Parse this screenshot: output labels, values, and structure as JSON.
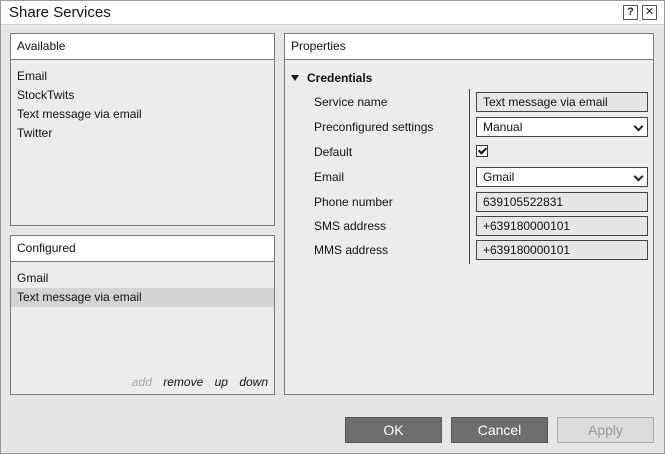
{
  "window": {
    "title": "Share Services",
    "help_label": "?",
    "close_label": "✕"
  },
  "available": {
    "header": "Available",
    "items": [
      "Email",
      "StockTwits",
      "Text message via email",
      "Twitter"
    ]
  },
  "configured": {
    "header": "Configured",
    "items": [
      "Gmail",
      "Text message via email"
    ],
    "selected_index": 1,
    "actions": {
      "add": "add",
      "remove": "remove",
      "up": "up",
      "down": "down"
    }
  },
  "properties": {
    "header": "Properties",
    "section": "Credentials",
    "rows": {
      "service_name": {
        "label": "Service name",
        "value": "Text message via email"
      },
      "preconfigured": {
        "label": "Preconfigured settings",
        "value": "Manual"
      },
      "default": {
        "label": "Default",
        "checked": true
      },
      "email": {
        "label": "Email",
        "value": "Gmail"
      },
      "phone": {
        "label": "Phone number",
        "value": "639105522831"
      },
      "sms": {
        "label": "SMS address",
        "value": "+639180000101"
      },
      "mms": {
        "label": "MMS address",
        "value": "+639180000101"
      }
    }
  },
  "buttons": {
    "ok": "OK",
    "cancel": "Cancel",
    "apply": "Apply"
  },
  "icons": {
    "collapse": "triangle-down-icon",
    "dropdown": "chevron-down-icon",
    "checkbox": "checkmark-icon"
  }
}
